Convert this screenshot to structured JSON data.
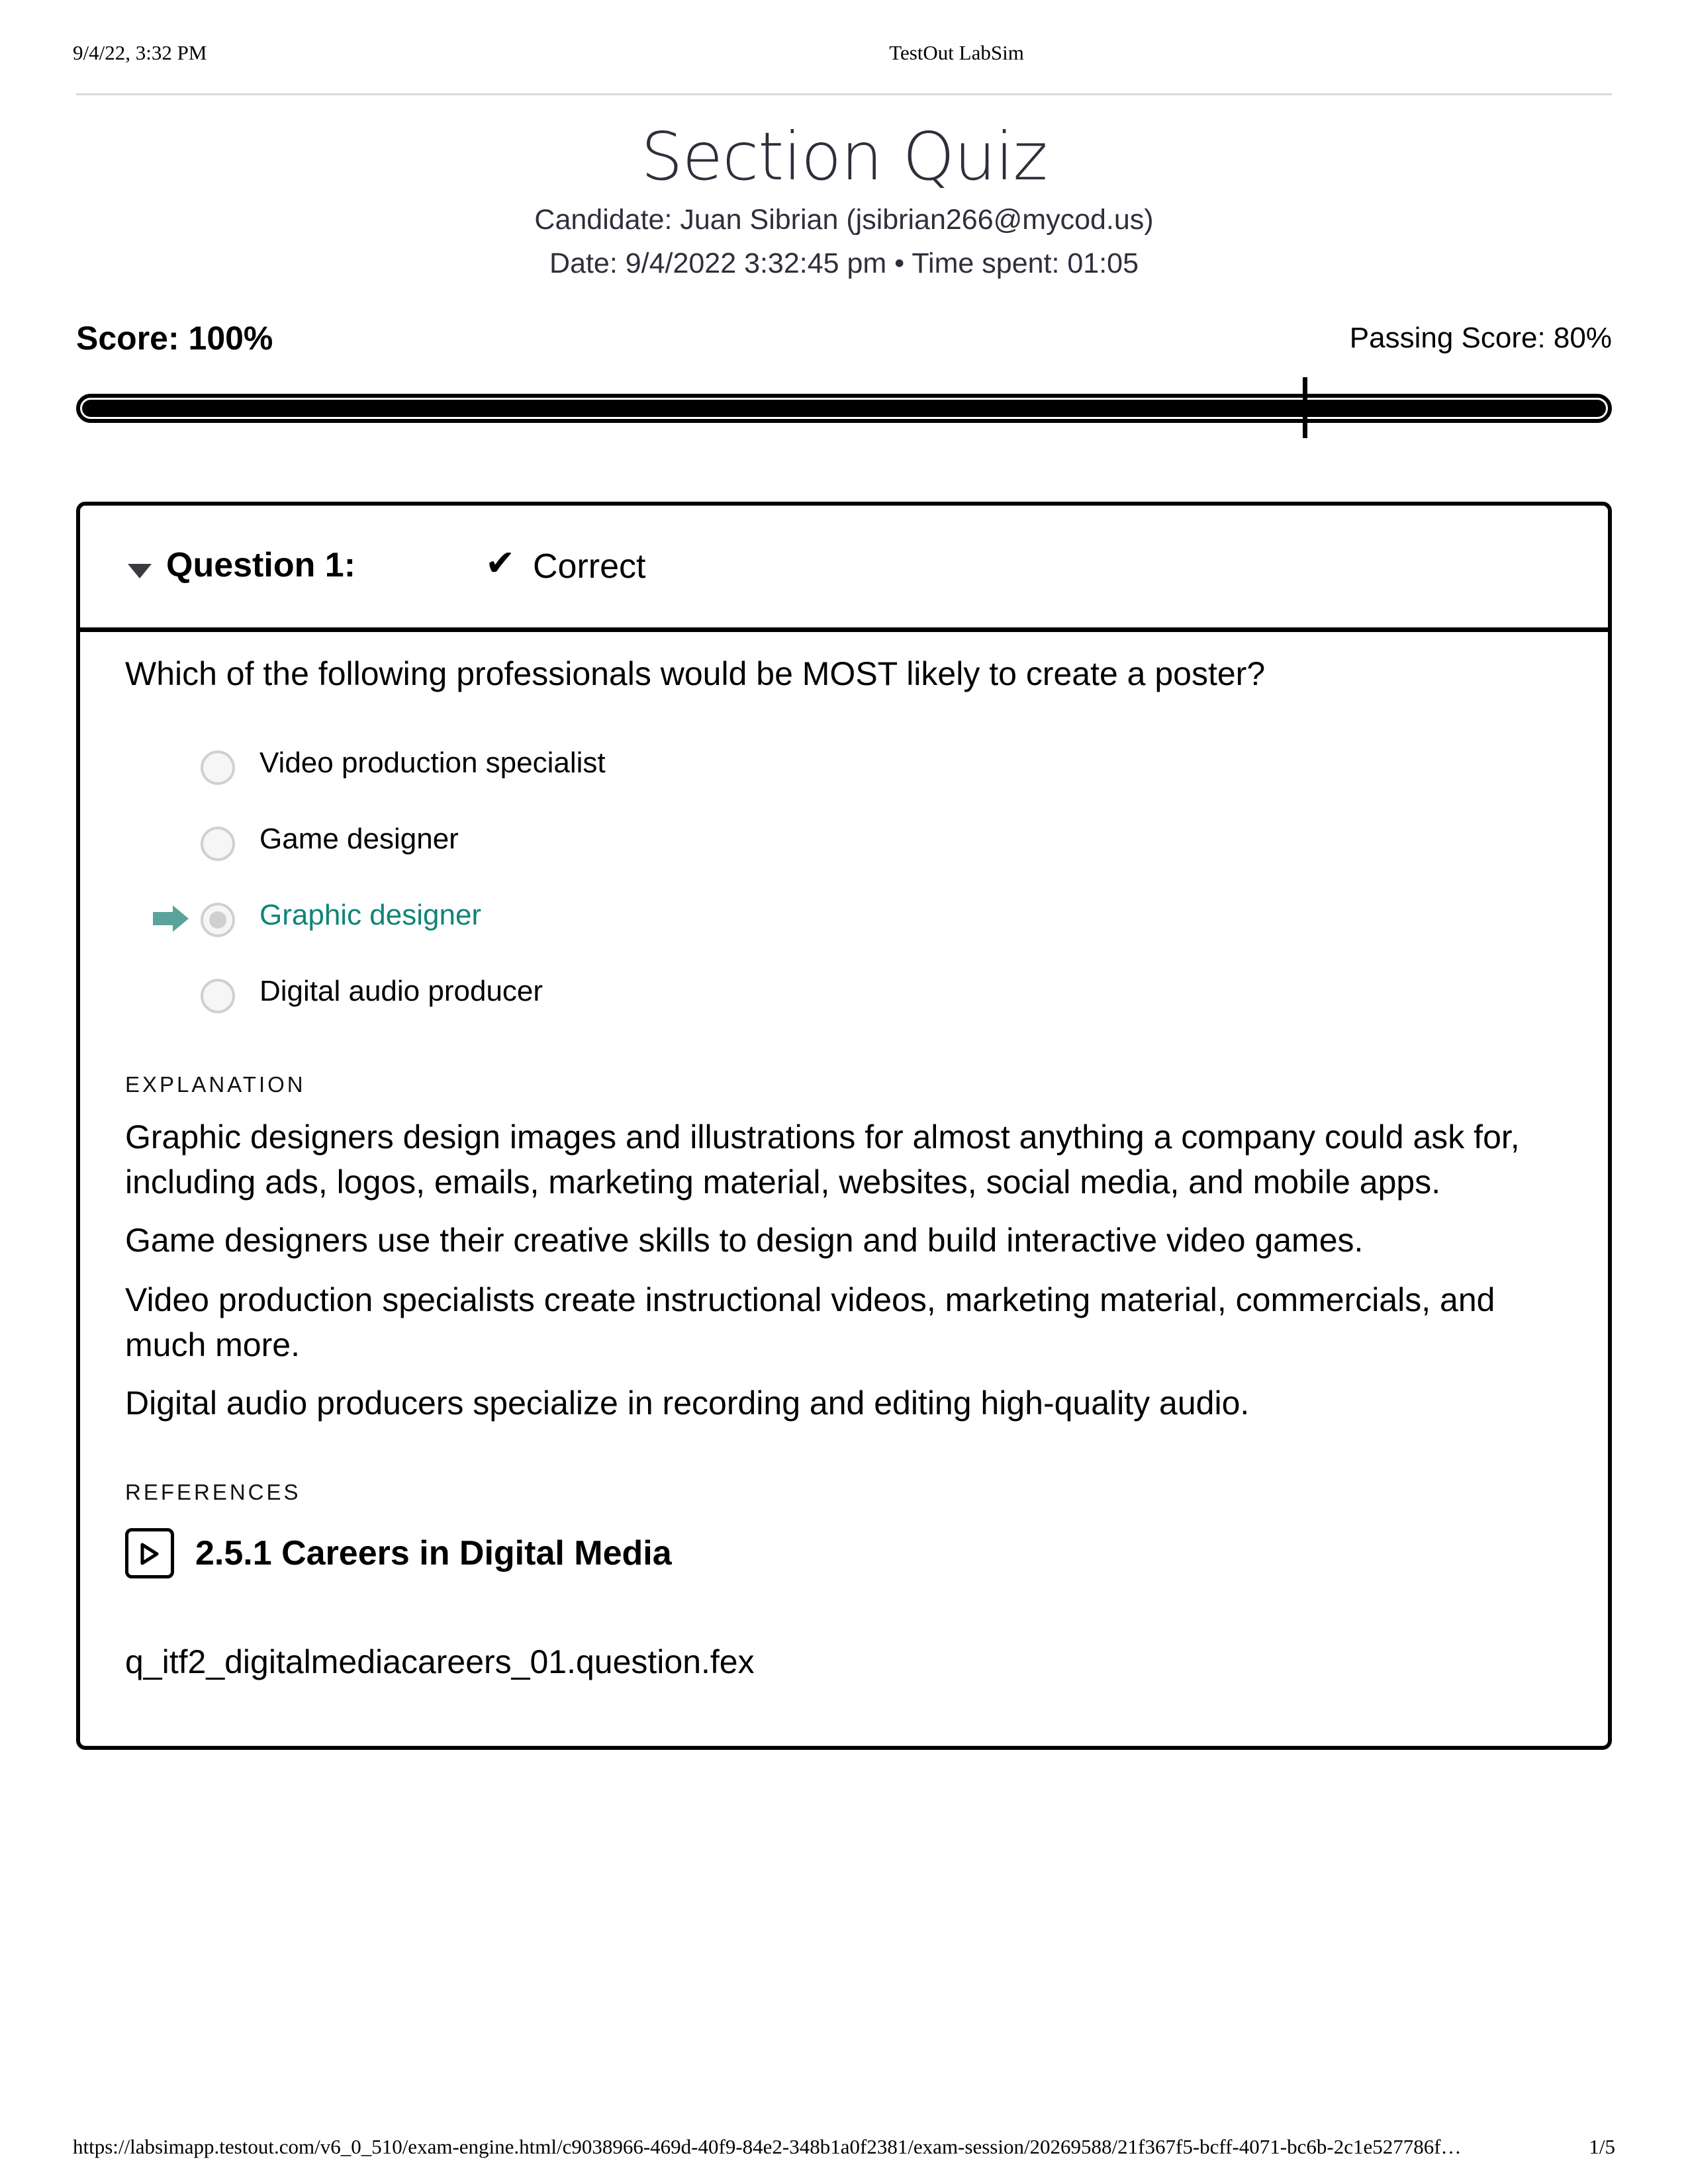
{
  "print_header": {
    "datetime": "9/4/22, 3:32 PM",
    "page_title": "TestOut LabSim"
  },
  "quiz": {
    "title": "Section Quiz",
    "candidate_line": "Candidate: Juan Sibrian  (jsibrian266@mycod.us)",
    "date_line": "Date: 9/4/2022 3:32:45 pm • Time spent: 01:05"
  },
  "score": {
    "label": "Score: 100%",
    "passing_label": "Passing Score: 80%",
    "value_percent": 100,
    "passing_percent": 80
  },
  "question": {
    "label": "Question 1:",
    "status": "Correct",
    "status_icon": "checkmark-icon",
    "expand_icon": "caret-down-icon",
    "text": "Which of the following professionals would be MOST likely to create a poster?",
    "options": [
      {
        "label": "Video production specialist",
        "selected": false,
        "correct": false
      },
      {
        "label": "Game designer",
        "selected": false,
        "correct": false
      },
      {
        "label": "Graphic designer",
        "selected": true,
        "correct": true
      },
      {
        "label": "Digital audio producer",
        "selected": false,
        "correct": false
      }
    ],
    "correct_color": "#0f8578",
    "arrow_color": "#5aa39a",
    "explanation_label": "EXPLANATION",
    "explanation": [
      "Graphic designers design images and illustrations for almost anything a company could ask for, including ads, logos, emails, marketing material, websites, social media, and mobile apps.",
      "Game designers use their creative skills to design and build interactive video games.",
      "Video production specialists create instructional videos, marketing material, commercials, and much more.",
      "Digital audio producers specialize in recording and editing high-quality audio."
    ],
    "references_label": "REFERENCES",
    "references": [
      {
        "icon": "play-video-icon",
        "label": "2.5.1 Careers in Digital Media"
      }
    ],
    "file_name": "q_itf2_digitalmediacareers_01.question.fex"
  },
  "print_footer": {
    "url": "https://labsimapp.testout.com/v6_0_510/exam-engine.html/c9038966-469d-40f9-84e2-348b1a0f2381/exam-session/20269588/21f367f5-bcff-4071-bc6b-2c1e527786f…",
    "page": "1/5"
  }
}
